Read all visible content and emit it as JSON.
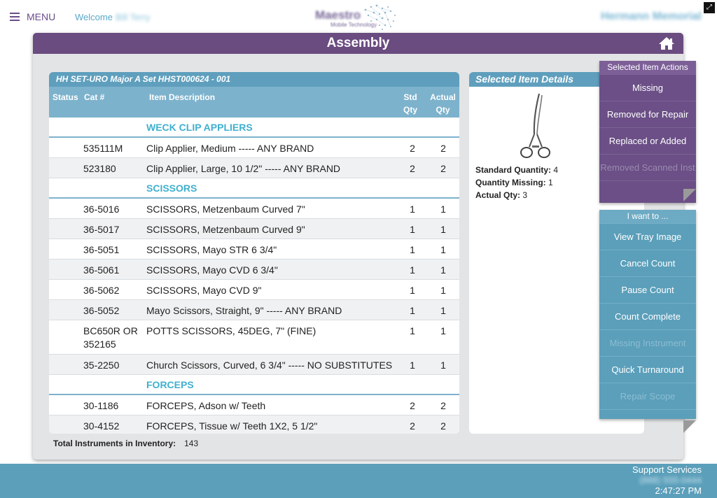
{
  "topbar": {
    "menu_label": "MENU",
    "welcome_label": "Welcome",
    "user_name": "Bill Terry",
    "logo_title": "Maestro",
    "logo_subtitle": "Mobile Technology",
    "hospital_name": "Hermann Memorial"
  },
  "panel": {
    "title": "Assembly"
  },
  "tray": {
    "title": "HH SET-URO Major A Set HHST000624 - 001",
    "columns": {
      "status": "Status",
      "cat": "Cat #",
      "desc": "Item Description",
      "std_qty": "Std Qty",
      "actual_qty": "Actual Qty"
    },
    "groups": [
      {
        "name": "WECK CLIP APPLIERS",
        "items": [
          {
            "cat": "535111M",
            "desc": "Clip Applier, Medium ----- ANY BRAND",
            "std": "2",
            "act": "2"
          },
          {
            "cat": "523180",
            "desc": "Clip Applier, Large, 10 1/2\" ----- ANY BRAND",
            "std": "2",
            "act": "2"
          }
        ]
      },
      {
        "name": "SCISSORS",
        "items": [
          {
            "cat": "36-5016",
            "desc": "SCISSORS, Metzenbaum Curved 7\"",
            "std": "1",
            "act": "1"
          },
          {
            "cat": "36-5017",
            "desc": "SCISSORS, Metzenbaum Curved 9\"",
            "std": "1",
            "act": "1"
          },
          {
            "cat": "36-5051",
            "desc": "SCISSORS, Mayo STR 6 3/4\"",
            "std": "1",
            "act": "1"
          },
          {
            "cat": "36-5061",
            "desc": "SCISSORS, Mayo CVD 6 3/4\"",
            "std": "1",
            "act": "1"
          },
          {
            "cat": "36-5062",
            "desc": "SCISSORS, Mayo CVD 9\"",
            "std": "1",
            "act": "1"
          },
          {
            "cat": "36-5052",
            "desc": "Mayo Scissors, Straight, 9\" ----- ANY BRAND",
            "std": "1",
            "act": "1"
          },
          {
            "cat": "BC650R OR",
            "cat2": "352165",
            "desc": "POTTS SCISSORS, 45DEG, 7\" (FINE)",
            "std": "1",
            "act": "1"
          },
          {
            "cat": "35-2250",
            "desc": "Church Scissors, Curved, 6 3/4\" ----- NO SUBSTITUTES",
            "std": "1",
            "act": "1"
          }
        ]
      },
      {
        "name": "FORCEPS",
        "items": [
          {
            "cat": "30-1186",
            "desc": "FORCEPS, Adson w/ Teeth",
            "std": "2",
            "act": "2"
          },
          {
            "cat": "30-4152",
            "desc": "FORCEPS, Tissue w/ Teeth 1X2, 5 1/2\"",
            "std": "2",
            "act": "2"
          }
        ]
      }
    ],
    "total_label": "Total Instruments in Inventory:",
    "total_value": "143"
  },
  "details": {
    "title": "Selected Item Details",
    "standard_label": "Standard Quantity:",
    "standard_value": "4",
    "missing_label": "Quantity Missing:",
    "missing_value": "1",
    "actual_label": "Actual Qty:",
    "actual_value": "3"
  },
  "item_actions": {
    "title": "Selected Item Actions",
    "items": [
      {
        "label": "Missing",
        "enabled": true
      },
      {
        "label": "Removed for Repair",
        "enabled": true
      },
      {
        "label": "Replaced or Added",
        "enabled": true
      },
      {
        "label": "Removed Scanned Inst",
        "enabled": false
      }
    ]
  },
  "i_want_to": {
    "title": "I want to ...",
    "items": [
      {
        "label": "View Tray Image",
        "enabled": true
      },
      {
        "label": "Cancel Count",
        "enabled": true
      },
      {
        "label": "Pause Count",
        "enabled": true
      },
      {
        "label": "Count Complete",
        "enabled": true
      },
      {
        "label": "Missing Instrument",
        "enabled": false
      },
      {
        "label": "Quick Turnaround",
        "enabled": true
      },
      {
        "label": "Repair Scope",
        "enabled": false
      }
    ]
  },
  "footer": {
    "support_label": "Support Services",
    "phone": "(888) 555-0444",
    "time": "2:47:27 PM"
  },
  "colors": {
    "purple": "#6a4c80",
    "teal": "#5f9fbd",
    "group_heading": "#3fb0cf"
  },
  "icons": [
    "hamburger-icon",
    "home-icon",
    "expand-icon"
  ]
}
